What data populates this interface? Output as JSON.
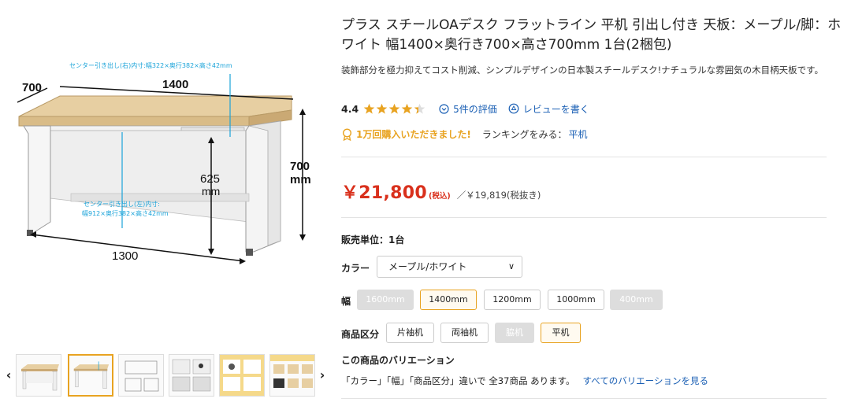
{
  "product": {
    "title": "プラス スチールOAデスク フラットライン 平机 引出し付き 天板：メープル/脚：ホワイト 幅1400×奥行き700×高さ700mm 1台(2梱包)",
    "description": "装飾部分を極力抑えてコスト削減、シンプルデザインの日本製スチールデスク!ナチュラルな雰囲気の木目柄天板です。"
  },
  "image": {
    "dim_depth": "700",
    "dim_width": "1400",
    "dim_height": "700",
    "dim_height_unit": "mm",
    "dim_leg": "625",
    "dim_leg_unit": "mm",
    "dim_bottom": "1300",
    "drawer_right": "センター引き出し(右)内寸:幅322×奥行382×高さ42mm",
    "drawer_left_1": "センター引き出し(左)内寸:",
    "drawer_left_2": "幅912×奥行382×高さ42mm"
  },
  "thumbnails": {
    "prev": "‹",
    "next": "›",
    "selected_index": 1,
    "count": 6
  },
  "rating": {
    "score": "4.4",
    "score_value": 4.4,
    "max": 5,
    "count_label": "5件の評価",
    "review_label": "レビューを書く"
  },
  "purchase": {
    "badge": "1万回購入いただきました!",
    "ranking_label": "ランキングをみる：",
    "ranking_link": "平机"
  },
  "price": {
    "main": "￥21,800",
    "tax_in": "(税込)",
    "tax_ex": "／￥19,819(税抜き)"
  },
  "unit": "販売単位：1台",
  "options": {
    "color_label": "カラー",
    "color_value": "メープル/ホワイト",
    "width_label": "幅",
    "widths": [
      {
        "label": "1600mm",
        "state": "disabled"
      },
      {
        "label": "1400mm",
        "state": "active"
      },
      {
        "label": "1200mm",
        "state": "normal"
      },
      {
        "label": "1000mm",
        "state": "normal"
      },
      {
        "label": "400mm",
        "state": "disabled"
      }
    ],
    "type_label": "商品区分",
    "types": [
      {
        "label": "片袖机",
        "state": "normal"
      },
      {
        "label": "両袖机",
        "state": "normal"
      },
      {
        "label": "脇机",
        "state": "disabled"
      },
      {
        "label": "平机",
        "state": "active"
      }
    ]
  },
  "variation": {
    "title": "この商品のバリエーション",
    "text": "「カラー」「幅」「商品区分」違いで 全37商品 あります。",
    "link": "すべてのバリエーションを見る"
  },
  "colors": {
    "accent": "#e8a321",
    "price": "#d9301c",
    "link": "#1a5fb4",
    "dim_blue": "#1aa3d9"
  }
}
